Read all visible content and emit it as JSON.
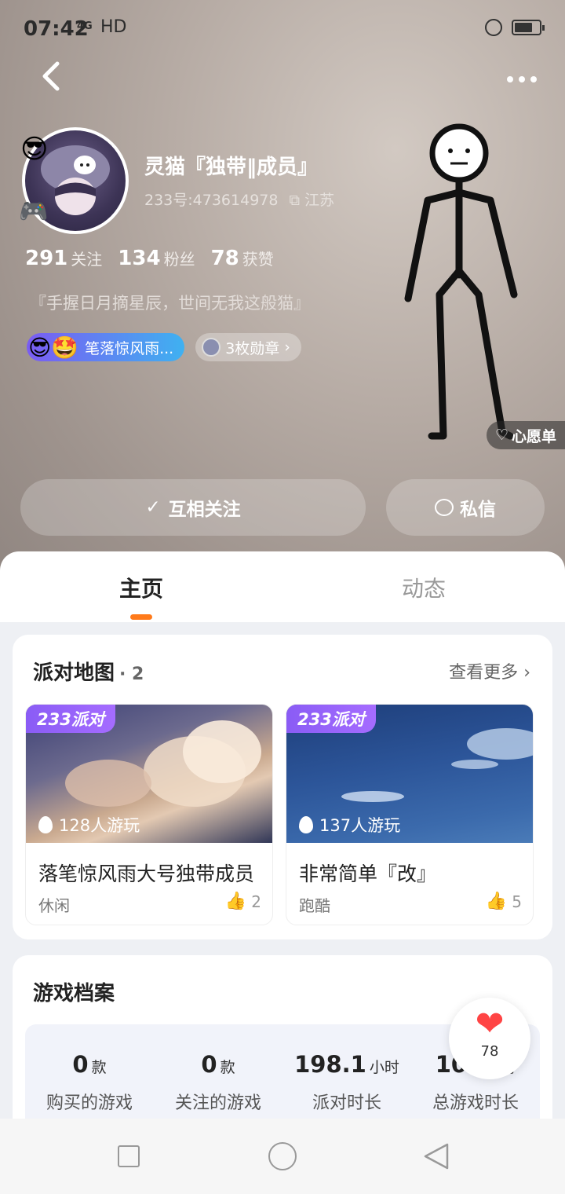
{
  "status_bar": {
    "time": "07:42",
    "signal": "4G",
    "hd": "HD"
  },
  "profile": {
    "username": "灵猫『独带‖成员』",
    "uid": "233号:473614978",
    "location": "江苏",
    "stats": [
      {
        "value": "291",
        "label": "关注"
      },
      {
        "value": "134",
        "label": "粉丝"
      },
      {
        "value": "78",
        "label": "获赞"
      }
    ],
    "bio": "『手握日月摘星辰，世间无我这般猫』",
    "badge_text": "笔落惊风雨...",
    "medals_text": "3枚勋章",
    "wishlist_label": "心愿单",
    "follow_label": "互相关注",
    "message_label": "私信"
  },
  "tabs": [
    {
      "label": "主页",
      "active": true
    },
    {
      "label": "动态",
      "active": false
    }
  ],
  "party_maps": {
    "title": "派对地图",
    "count": "· 2",
    "more_label": "查看更多",
    "tag": "233派对",
    "items": [
      {
        "players": "128人游玩",
        "name": "落笔惊风雨大号独带成员",
        "genre": "休闲",
        "likes": "2"
      },
      {
        "players": "137人游玩",
        "name": "非常简单『改』",
        "genre": "跑酷",
        "likes": "5"
      }
    ]
  },
  "game_archive": {
    "title": "游戏档案",
    "stats": [
      {
        "value": "0",
        "unit": "款",
        "label": "购买的游戏"
      },
      {
        "value": "0",
        "unit": "款",
        "label": "关注的游戏"
      },
      {
        "value": "198.1",
        "unit": "小时",
        "label": "派对时长"
      },
      {
        "value": "107",
        "unit": "小时",
        "label": "总游戏时长"
      }
    ]
  },
  "like_fab": {
    "count": "78"
  },
  "colors": {
    "accent": "#ff7a1a",
    "badge_start": "#7a5cf2",
    "badge_end": "#3fb1f1",
    "heart": "#ff4444"
  }
}
